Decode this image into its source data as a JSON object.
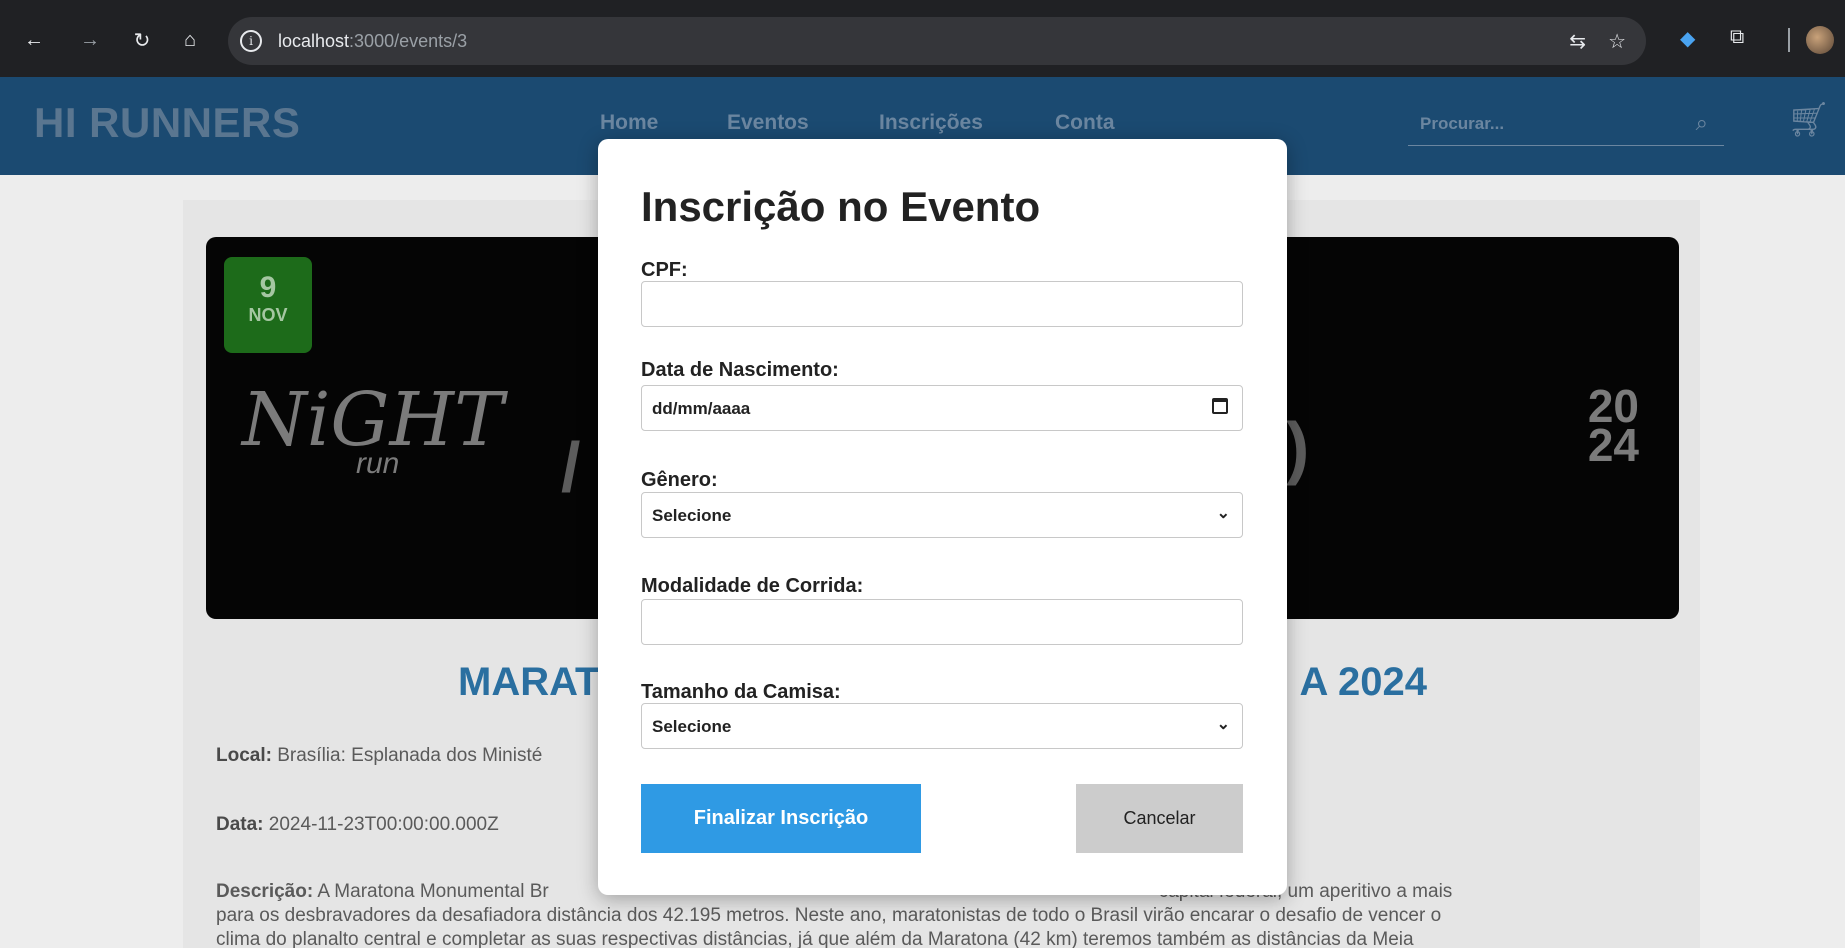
{
  "browser": {
    "url_host": "localhost",
    "url_rest": ":3000/events/3"
  },
  "header": {
    "brand": "HI RUNNERS",
    "nav": [
      "Home",
      "Eventos",
      "Inscrições",
      "Conta"
    ],
    "search_placeholder": "Procurar..."
  },
  "banner": {
    "day": "9",
    "month": "NOV",
    "logo_main": "NiGHT",
    "logo_sub": "run",
    "year_top": "20",
    "year_bottom": "24"
  },
  "event": {
    "title_left": "MARAT",
    "title_right": "A 2024",
    "local_label": "Local:",
    "local_value": "Brasília: Esplanada dos Ministé",
    "data_label": "Data:",
    "data_value": "2024-11-23T00:00:00.000Z",
    "desc_label": "Descrição:",
    "desc_line1_a": "A Maratona Monumental Br",
    "desc_line1_b": "capital federal, um aperitivo a mais",
    "desc_line2": "para os desbravadores da desafiadora distância dos 42.195 metros. Neste ano, maratonistas de todo o Brasil virão encarar o desafio de vencer o",
    "desc_line3": "clima do planalto central e completar as suas respectivas distâncias, já que além da Maratona (42 km) teremos também as distâncias da Meia"
  },
  "modal": {
    "title": "Inscrição no Evento",
    "cpf_label": "CPF:",
    "cpf_value": "",
    "birth_label": "Data de Nascimento:",
    "birth_value": "dd/mm/aaaa",
    "gender_label": "Gênero:",
    "gender_value": "Selecione",
    "modality_label": "Modalidade de Corrida:",
    "modality_value": "",
    "shirt_label": "Tamanho da Camisa:",
    "shirt_value": "Selecione",
    "submit_label": "Finalizar Inscrição",
    "cancel_label": "Cancelar"
  }
}
